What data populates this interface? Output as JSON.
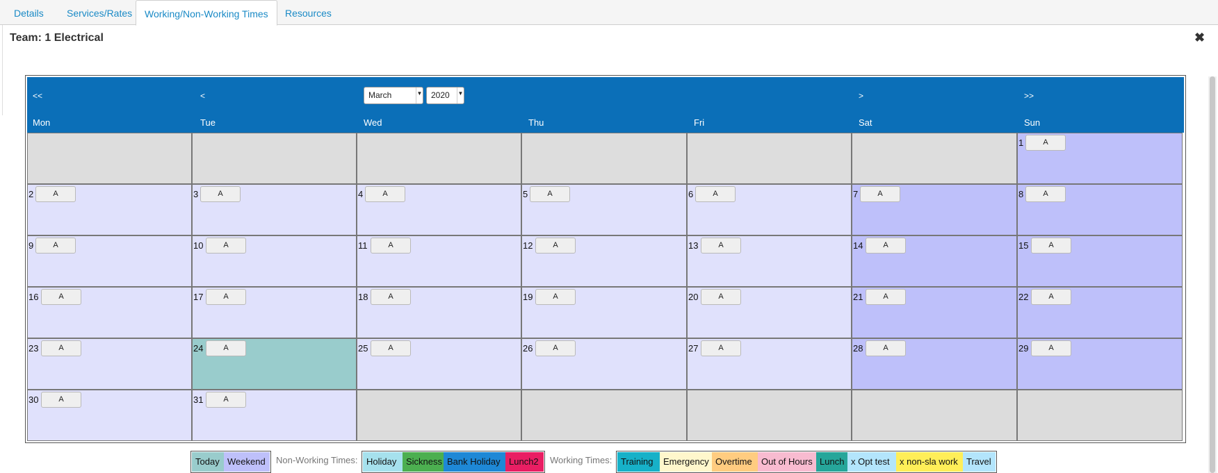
{
  "tabs": [
    {
      "label": "Details"
    },
    {
      "label": "Services/Rates"
    },
    {
      "label": "Working/Non-Working Times"
    },
    {
      "label": "Resources"
    }
  ],
  "header": {
    "title": "Team: 1 Electrical"
  },
  "calendar": {
    "nav": {
      "first": "<<",
      "prev": "<",
      "next": ">",
      "last": ">>"
    },
    "month": "March",
    "year": "2020",
    "weekdays": [
      "Mon",
      "Tue",
      "Wed",
      "Thu",
      "Fri",
      "Sat",
      "Sun"
    ],
    "button_label": "A",
    "days": [
      "1",
      "2",
      "3",
      "4",
      "5",
      "6",
      "7",
      "8",
      "9",
      "10",
      "11",
      "12",
      "13",
      "14",
      "15",
      "16",
      "17",
      "18",
      "19",
      "20",
      "21",
      "22",
      "23",
      "24",
      "25",
      "26",
      "27",
      "28",
      "29",
      "30",
      "31"
    ],
    "colors": {
      "header": "#0b6fb8",
      "weekday": "#e0e1fc",
      "weekend": "#bec0fa",
      "today": "#99cccc",
      "empty_before": "#dddddd",
      "empty_after": "#dcdcdc"
    }
  },
  "legend": {
    "general": [
      {
        "label": "Today",
        "color": "#99cccc"
      },
      {
        "label": "Weekend",
        "color": "#bec0fa"
      }
    ],
    "non_working_label": "Non-Working Times:",
    "non_working": [
      {
        "label": "Holiday",
        "color": "#a6e1ed"
      },
      {
        "label": "Sickness",
        "color": "#4caf50"
      },
      {
        "label": "Bank Holiday",
        "color": "#1e88d6"
      },
      {
        "label": "Lunch2",
        "color": "#e91e63"
      }
    ],
    "working_label": "Working Times:",
    "working": [
      {
        "label": "Training",
        "color": "#17b1c8"
      },
      {
        "label": "Emergency",
        "color": "#fff7cc"
      },
      {
        "label": "Overtime",
        "color": "#ffcc80"
      },
      {
        "label": "Out of Hours",
        "color": "#f8bbd0"
      },
      {
        "label": "Lunch",
        "color": "#26a69a"
      },
      {
        "label": "x Opt test",
        "color": "#b3e5fc"
      },
      {
        "label": "x non-sla work",
        "color": "#ffee58"
      },
      {
        "label": "Travel",
        "color": "#b3e5fc"
      }
    ]
  }
}
